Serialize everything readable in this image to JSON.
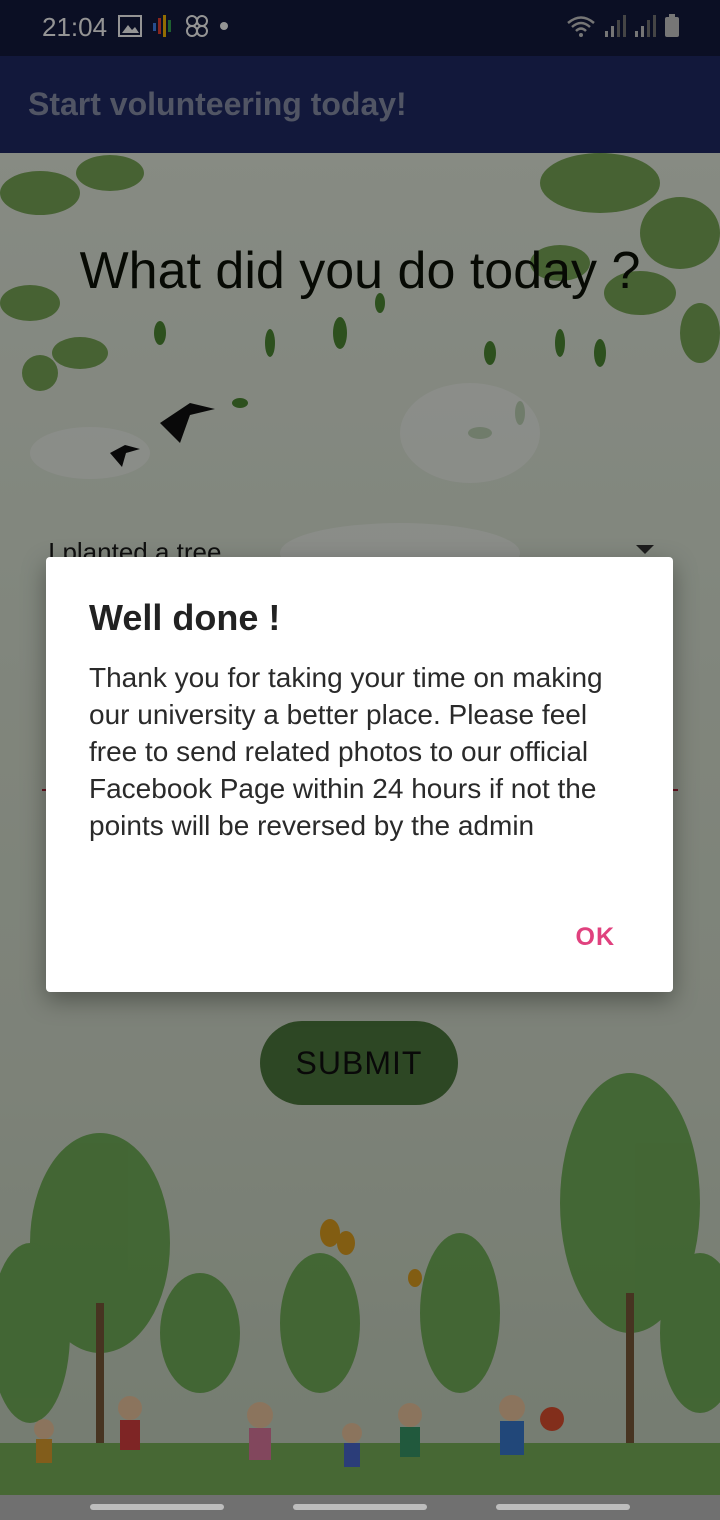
{
  "status_bar": {
    "time": "21:04",
    "left_icons": [
      "image-icon",
      "assistant-dots-icon",
      "link-icon",
      "notification-dot-icon"
    ],
    "right_icons": [
      "wifi-icon",
      "signal-icon",
      "signal-icon-2",
      "battery-icon"
    ]
  },
  "app_bar": {
    "title": "Start volunteering today!"
  },
  "main": {
    "question": "What did you do today ?",
    "activity_select": {
      "value": "I planted a tree"
    },
    "submit_label": "SUBMIT"
  },
  "dialog": {
    "title": "Well done !",
    "message": "Thank you for taking your time on making our university a better place. Please feel free to send related photos to our official Facebook Page within 24 hours if not the points will be reversed by the admin",
    "ok_label": "OK"
  },
  "colors": {
    "status_bar": "#141a3e",
    "app_bar": "#1f2a66",
    "submit_button": "#4f7a3e",
    "dialog_accent": "#e0417e",
    "field_underline": "#b0223a"
  }
}
